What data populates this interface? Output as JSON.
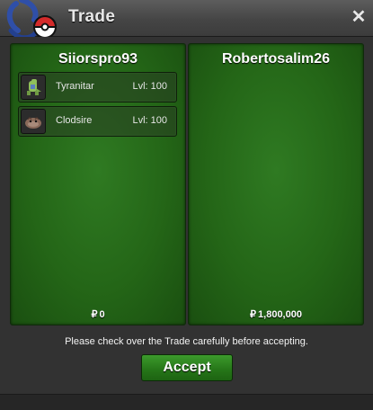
{
  "window": {
    "title": "Trade",
    "close_label": "✕"
  },
  "trade": {
    "left_player": {
      "name": "Siiorspro93",
      "pokemon": [
        {
          "name": "Tyranitar",
          "level": "Lvl: 100"
        },
        {
          "name": "Clodsire",
          "level": "Lvl: 100"
        }
      ],
      "currency_symbol": "₽",
      "money": "0"
    },
    "right_player": {
      "name": "Robertosalim26",
      "pokemon": [],
      "currency_symbol": "₽",
      "money": "1,800,000"
    },
    "notice": "Please check over the Trade carefully before accepting.",
    "accept_label": "Accept"
  },
  "icons": {
    "logo": "pokeball-logo-icon",
    "close": "close-icon",
    "pokemon_1": "tyranitar-sprite-icon",
    "pokemon_2": "clodsire-sprite-icon"
  },
  "colors": {
    "panel_green": "#246617",
    "accept_green": "#257518",
    "titlebar": "#4a4a4a",
    "background": "#323232"
  }
}
